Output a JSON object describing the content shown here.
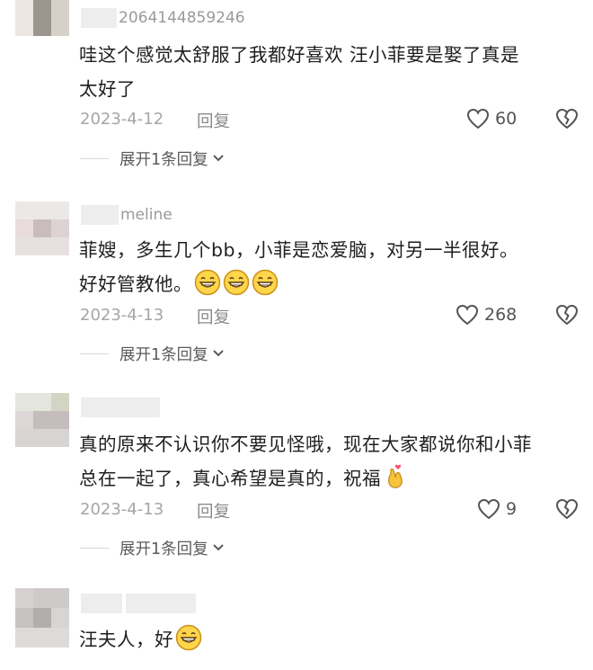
{
  "comments": [
    {
      "username": "2064144859246",
      "text_lines": [
        "哇这个感觉太舒服了我都好喜欢 汪小菲要是娶了真是",
        "太好了"
      ],
      "date": "2023-4-12",
      "reply_label": "回复",
      "likes": "60",
      "expand_label": "展开1条回复"
    },
    {
      "username": "meline",
      "text_lines": [
        "菲嫂，多生几个bb，小菲是恋爱脑，对另一半很好。",
        "好好管教他。"
      ],
      "date": "2023-4-13",
      "reply_label": "回复",
      "likes": "268",
      "expand_label": "展开1条回复"
    },
    {
      "username": "",
      "text_lines": [
        "真的原来不认识你不要见怪哦，现在大家都说你和小菲",
        "总在一起了，真心希望是真的，祝福"
      ],
      "date": "2023-4-13",
      "reply_label": "回复",
      "likes": "9",
      "expand_label": "展开1条回复"
    },
    {
      "username": "",
      "text_lines": [
        "汪夫人，好"
      ]
    }
  ],
  "icons": {
    "like": "heart-outline-icon",
    "dislike": "broken-heart-icon",
    "expand": "chevron-down-icon",
    "emoji_grin": "grinning-emoji",
    "emoji_finger_heart": "finger-heart-emoji"
  }
}
